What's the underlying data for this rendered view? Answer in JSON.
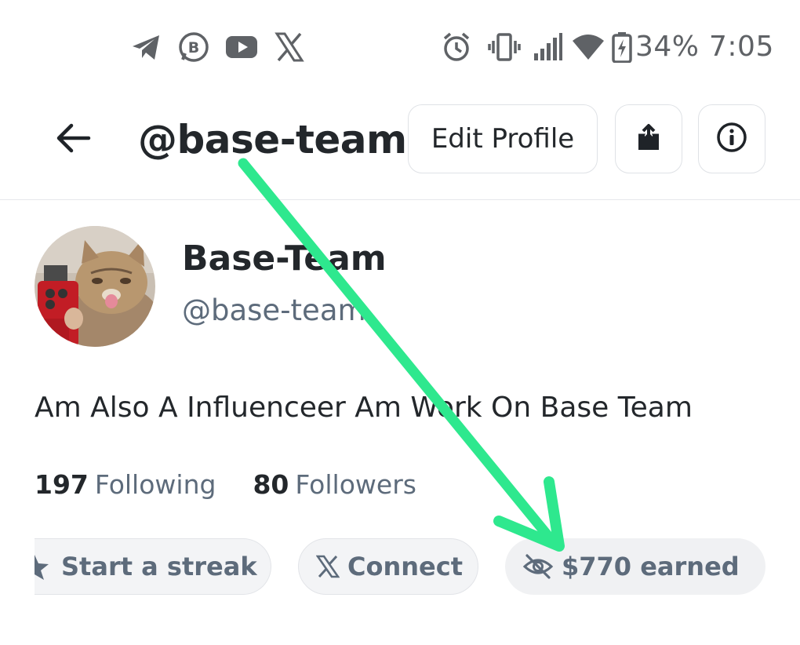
{
  "status_bar": {
    "battery": "34%",
    "time": "7:05",
    "left_icons": [
      "telegram-icon",
      "whatsapp-business-icon",
      "youtube-icon",
      "x-icon"
    ],
    "right_icons": [
      "alarm-icon",
      "vibrate-icon",
      "signal-icon",
      "wifi-icon",
      "battery-charging-icon"
    ]
  },
  "header": {
    "title": "@base-team",
    "edit_profile_label": "Edit Profile",
    "icons": [
      "back-arrow-icon",
      "share-icon",
      "info-icon"
    ]
  },
  "profile": {
    "display_name": "Base-Team",
    "username": "@base-team",
    "bio": "Am Also A Influenceer Am Work On Base Team",
    "following_count": "197",
    "following_label": "Following",
    "followers_count": "80",
    "followers_label": "Followers"
  },
  "actions": {
    "streak_label": "Start a streak",
    "connect_label": "Connect",
    "earned_label": "$770 earned"
  },
  "colors": {
    "text_primary": "#23272b",
    "text_secondary": "#5d6b7b",
    "annotation_arrow": "#2ee88e",
    "pill_bg": "#f3f4f6"
  }
}
